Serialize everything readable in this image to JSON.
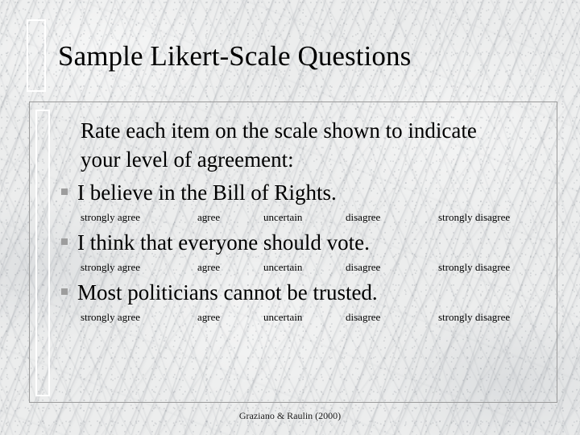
{
  "slide": {
    "title": "Sample Likert-Scale Questions",
    "intro": "Rate each item on the scale shown to indicate your level of agreement:",
    "footer": "Graziano & Raulin (2000)",
    "bullet_color": "#9d9d9d",
    "text_color": "#000000",
    "frame_color": "#9a9a9a",
    "deco_color": "#ffffff",
    "background_color": "#eceded"
  },
  "scale_labels": [
    "strongly agree",
    "agree",
    "uncertain",
    "disagree",
    "strongly disagree"
  ],
  "questions": [
    {
      "text": "I believe in the Bill of Rights.",
      "scale": [
        "strongly agree",
        "agree",
        "uncertain",
        "disagree",
        "strongly disagree"
      ]
    },
    {
      "text": "I think that everyone should vote.",
      "scale": [
        "strongly agree",
        "agree",
        "uncertain",
        "disagree",
        "strongly disagree"
      ]
    },
    {
      "text": "Most politicians cannot be trusted.",
      "scale": [
        "strongly agree",
        "agree",
        "uncertain",
        "disagree",
        "strongly disagree"
      ]
    }
  ]
}
